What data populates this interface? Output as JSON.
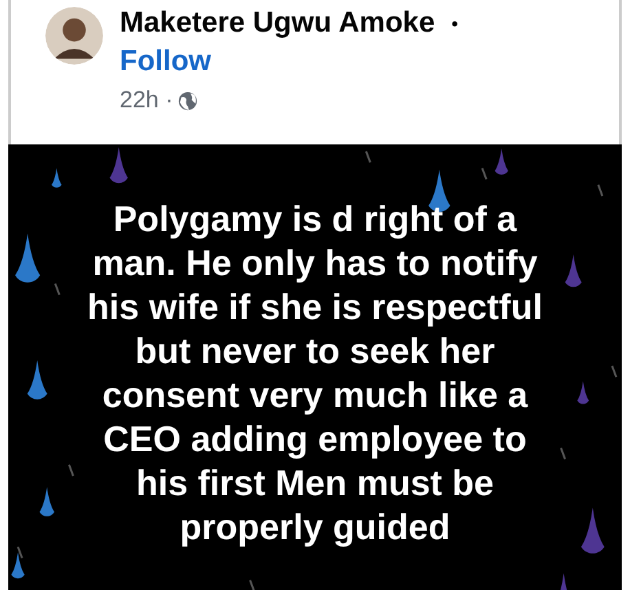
{
  "post": {
    "author": "Maketere Ugwu Amoke",
    "separator": "•",
    "follow": "Follow",
    "time": "22h ·",
    "text_lines": [
      "Polygamy is d right of a",
      "man. He only has to notify",
      "his wife if she is respectful",
      "but never to seek her",
      "consent very much like a",
      "CEO adding employee to",
      "his first Men must be",
      "properly guided"
    ]
  }
}
